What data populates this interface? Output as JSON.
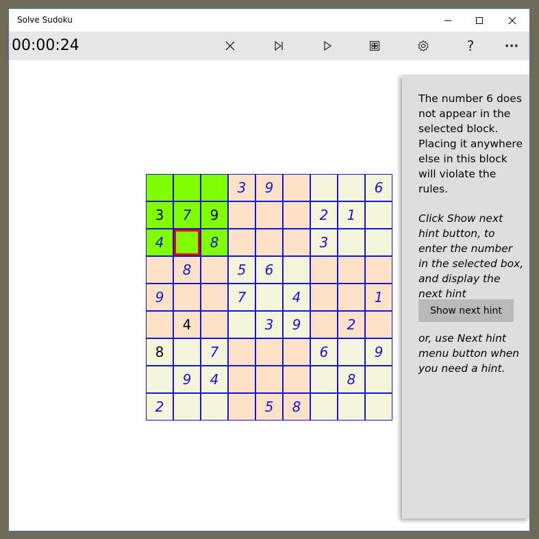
{
  "window": {
    "title": "Solve Sudoku"
  },
  "toolbar": {
    "timer": "00:00:24",
    "buttons": [
      {
        "name": "clear",
        "icon": "close-icon"
      },
      {
        "name": "next-hint",
        "icon": "skip-next-icon"
      },
      {
        "name": "play",
        "icon": "play-icon"
      },
      {
        "name": "grid",
        "icon": "grid-icon"
      },
      {
        "name": "settings",
        "icon": "gear-icon"
      },
      {
        "name": "help",
        "icon": "question-icon",
        "glyph": "?"
      },
      {
        "name": "more",
        "icon": "more-icon",
        "glyph": "···"
      }
    ]
  },
  "colors": {
    "highlight": "#80ff00",
    "block_peach": "#fde2c8",
    "block_cream": "#f5f5dc",
    "grid_line": "#1414d4",
    "entered_text": "#1414d4",
    "selected_border": "#e60000"
  },
  "board": {
    "values": [
      [
        "",
        "",
        "",
        "3",
        "9",
        "",
        "",
        "",
        "6"
      ],
      [
        "3",
        "7",
        "9",
        "",
        "",
        "",
        "2",
        "1",
        ""
      ],
      [
        "4",
        "",
        "8",
        "",
        "",
        "",
        "3",
        "",
        ""
      ],
      [
        "",
        "8",
        "",
        "5",
        "6",
        "",
        "",
        "",
        ""
      ],
      [
        "9",
        "",
        "",
        "7",
        "",
        "4",
        "",
        "",
        "1"
      ],
      [
        "",
        "4",
        "",
        "",
        "3",
        "9",
        "",
        "2",
        ""
      ],
      [
        "8",
        "",
        "7",
        "",
        "",
        "",
        "6",
        "",
        "9"
      ],
      [
        "",
        "9",
        "4",
        "",
        "",
        "",
        "",
        "8",
        ""
      ],
      [
        "2",
        "",
        "",
        "",
        "5",
        "8",
        "",
        "",
        ""
      ]
    ],
    "given": [
      [
        0,
        0,
        0,
        0,
        0,
        0,
        0,
        0,
        0
      ],
      [
        1,
        0,
        1,
        0,
        0,
        0,
        0,
        0,
        0
      ],
      [
        0,
        0,
        0,
        0,
        0,
        0,
        0,
        0,
        0
      ],
      [
        0,
        0,
        0,
        0,
        0,
        0,
        0,
        0,
        0
      ],
      [
        0,
        0,
        0,
        0,
        0,
        0,
        0,
        0,
        0
      ],
      [
        0,
        1,
        0,
        0,
        0,
        0,
        0,
        0,
        0
      ],
      [
        1,
        0,
        0,
        0,
        0,
        0,
        0,
        0,
        0
      ],
      [
        0,
        0,
        0,
        0,
        0,
        0,
        0,
        0,
        0
      ],
      [
        0,
        0,
        0,
        0,
        0,
        0,
        0,
        0,
        0
      ]
    ],
    "highlighted_block": [
      0,
      0
    ],
    "selected_cell": [
      2,
      1
    ]
  },
  "hint_panel": {
    "message": "The number 6 does not appear in the selected block. Placing it anywhere else in this block will violate the rules.",
    "instructions": "Click Show next hint button, to enter the number in the selected box, and display the next hint",
    "button_label": "Show next hint",
    "footer": "or, use Next hint menu button when you need a hint."
  }
}
